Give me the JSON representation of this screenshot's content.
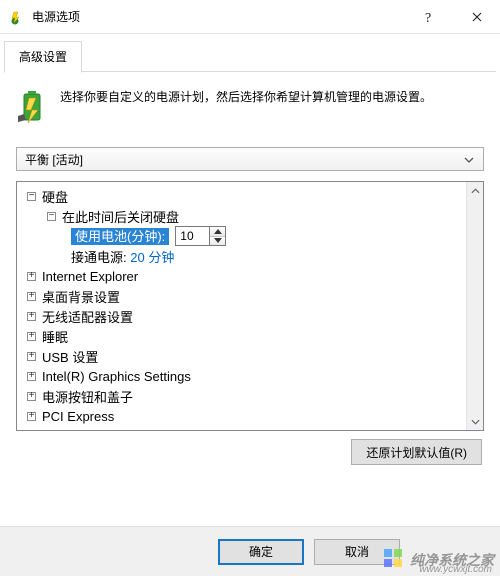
{
  "title": "电源选项",
  "tab_label": "高级设置",
  "intro": "选择你要自定义的电源计划，然后选择你希望计算机管理的电源设置。",
  "plan": "平衡 [活动]",
  "tree": {
    "root": "硬盘",
    "sub1": "在此时间后关闭硬盘",
    "battery_label": "使用电池(分钟):",
    "battery_value": "10",
    "plugged_label": "接通电源:",
    "plugged_value": "20 分钟",
    "items": [
      "Internet Explorer",
      "桌面背景设置",
      "无线适配器设置",
      "睡眠",
      "USB 设置",
      "Intel(R) Graphics Settings",
      "电源按钮和盖子",
      "PCI Express"
    ]
  },
  "restore_label": "还原计划默认值(R)",
  "ok_label": "确定",
  "cancel_label": "取消",
  "watermark": {
    "text": "纯净系统之家",
    "url": "www.ycwxjt.com"
  }
}
